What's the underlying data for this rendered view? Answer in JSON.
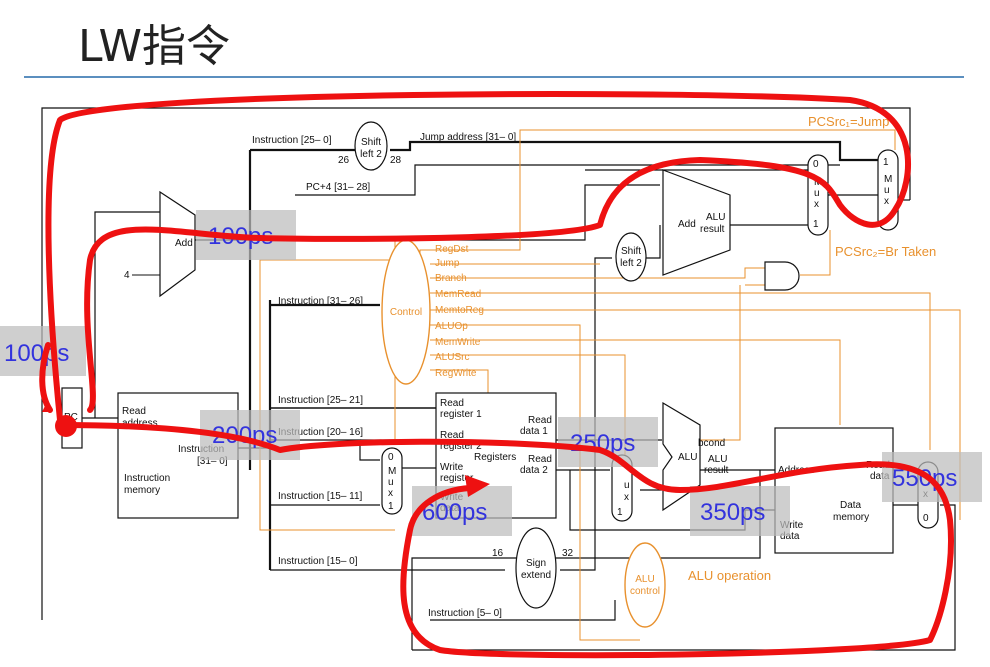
{
  "title": "LW指令",
  "labels": {
    "instr_25_0": "Instruction [25– 0]",
    "shift_left2_top": "Shift",
    "shift_left2_bot": "left 2",
    "n26": "26",
    "n28": "28",
    "jump_address": "Jump address [31– 0]",
    "pc4": "PC+4 [31– 28]",
    "pcsrc1": "PCSrc₁=Jump",
    "pcsrc2": "PCSrc₂=Br Taken",
    "add": "Add",
    "four": "4",
    "alu_result_top": "ALU",
    "alu_result_bot": "result",
    "add2": "Add",
    "shift2_top": "Shift",
    "shift2_bot": "left 2",
    "mux": "M u x",
    "mux0": "0",
    "mux1": "1",
    "control": "Control",
    "instr_31_26": "Instruction [31– 26]",
    "regdst": "RegDst",
    "jump": "Jump",
    "branch": "Branch",
    "memread": "MemRead",
    "memtoreg": "MemtoReg",
    "aluop": "ALUOp",
    "memwrite": "MemWrite",
    "alusrc": "ALUSrc",
    "regwrite": "RegWrite",
    "instr_25_21": "Instruction [25– 21]",
    "instr_20_16": "Instruction [20– 16]",
    "instr_15_11": "Instruction [15– 11]",
    "instr_15_0": "Instruction [15– 0]",
    "instr_5_0": "Instruction [5– 0]",
    "read_address": "Read address",
    "instruction_31_0": "Instruction [31– 0]",
    "instr_mem_top": "Instruction",
    "instr_mem_bot": "memory",
    "pc": "PC",
    "read_reg1": "Read register 1",
    "read_reg2": "Read register 2",
    "write_reg": "Write register",
    "write_data": "Write data",
    "registers": "Registers",
    "read_data1": "Read data 1",
    "read_data2": "Read data 2",
    "sign_extend_top": "Sign",
    "sign_extend_bot": "extend",
    "n16": "16",
    "n32": "32",
    "alu": "ALU",
    "bcond": "bcond",
    "alu_result2": "ALU result",
    "alu_control_top": "ALU",
    "alu_control_bot": "control",
    "alu_operation": "ALU operation",
    "dm_address": "Address",
    "dm_read_data": "Read data",
    "dm_write_data": "Write data",
    "dm_top": "Data",
    "dm_bot": "memory"
  },
  "timings": [
    "100ps",
    "100ps",
    "200ps",
    "250ps",
    "350ps",
    "550ps",
    "600ps"
  ],
  "colors": {
    "datapath": "#111111",
    "control": "#e8912e",
    "overlay": "#ee1111",
    "timing_text": "#3333dd"
  }
}
